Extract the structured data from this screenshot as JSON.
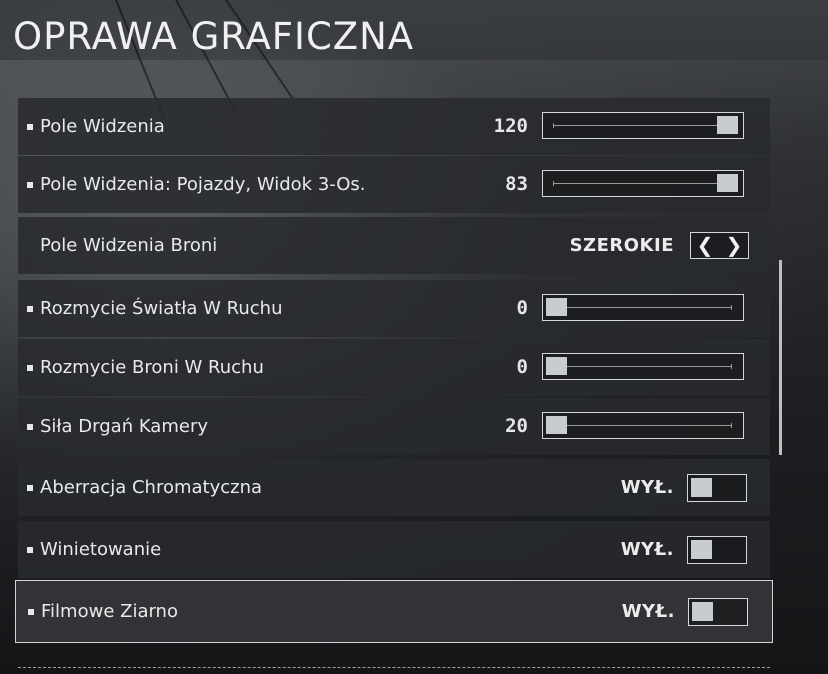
{
  "title": "OPRAWA GRAFICZNA",
  "settings": [
    {
      "label": "Pole Widzenia",
      "type": "slider",
      "value": "120",
      "fraction": 1.0,
      "bullet": true
    },
    {
      "label": "Pole Widzenia: Pojazdy, Widok 3-Os.",
      "type": "slider",
      "value": "83",
      "fraction": 1.0,
      "bullet": true
    },
    {
      "label": "Pole Widzenia Broni",
      "type": "cycle",
      "value": "SZEROKIE",
      "bullet": false
    },
    {
      "label": "Rozmycie Światła W Ruchu",
      "type": "slider",
      "value": "0",
      "fraction": 0.0,
      "bullet": true
    },
    {
      "label": "Rozmycie Broni W Ruchu",
      "type": "slider",
      "value": "0",
      "fraction": 0.0,
      "bullet": true
    },
    {
      "label": "Siła Drgań Kamery",
      "type": "slider",
      "value": "20",
      "fraction": 0.0,
      "bullet": true
    },
    {
      "label": "Aberracja Chromatyczna",
      "type": "toggle",
      "value": "WYŁ.",
      "bullet": true
    },
    {
      "label": "Winietowanie",
      "type": "toggle",
      "value": "WYŁ.",
      "bullet": true
    },
    {
      "label": "Filmowe Ziarno",
      "type": "toggle",
      "value": "WYŁ.",
      "bullet": true,
      "selected": true
    }
  ],
  "cycle_arrows": {
    "left": "❮",
    "right": "❯"
  },
  "icons": {
    "cycle_left": "chevron-left-icon",
    "cycle_right": "chevron-right-icon",
    "bullet": "square-bullet-icon"
  },
  "colors": {
    "panel": "#2a2c30",
    "text": "#e8e8e8",
    "accent": "#c8ccd0",
    "border": "#d6d6d6"
  }
}
